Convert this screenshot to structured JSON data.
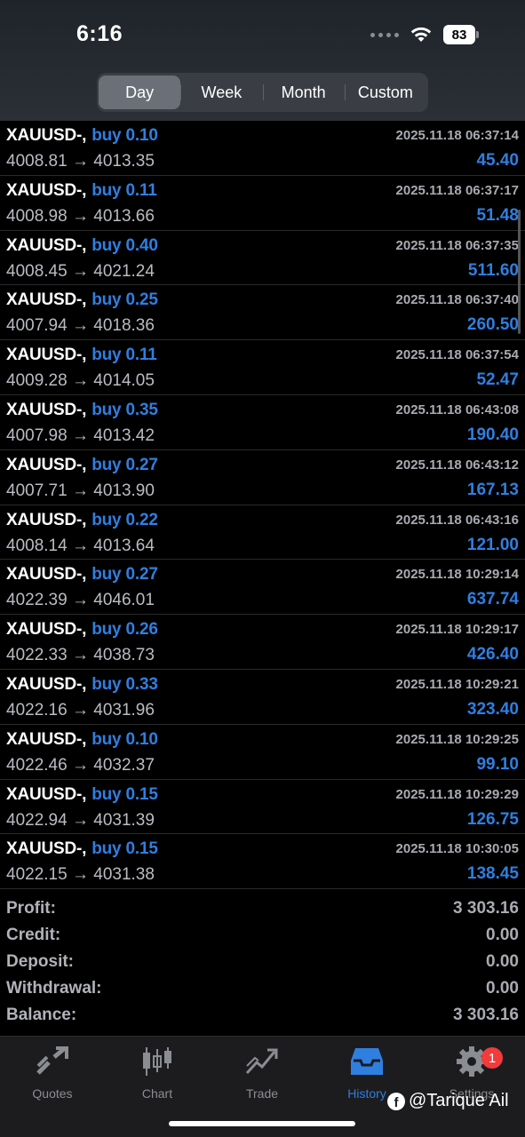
{
  "status": {
    "time": "6:16",
    "battery": "83"
  },
  "segments": [
    {
      "label": "Day",
      "active": true
    },
    {
      "label": "Week",
      "active": false
    },
    {
      "label": "Month",
      "active": false
    },
    {
      "label": "Custom",
      "active": false
    }
  ],
  "deals": [
    {
      "symbol": "XAUUSD-,",
      "dir": "buy 0.10",
      "open": "4008.81",
      "close": "4013.35",
      "time": "2025.11.18 06:37:14",
      "profit": "45.40"
    },
    {
      "symbol": "XAUUSD-,",
      "dir": "buy 0.11",
      "open": "4008.98",
      "close": "4013.66",
      "time": "2025.11.18 06:37:17",
      "profit": "51.48"
    },
    {
      "symbol": "XAUUSD-,",
      "dir": "buy 0.40",
      "open": "4008.45",
      "close": "4021.24",
      "time": "2025.11.18 06:37:35",
      "profit": "511.60"
    },
    {
      "symbol": "XAUUSD-,",
      "dir": "buy 0.25",
      "open": "4007.94",
      "close": "4018.36",
      "time": "2025.11.18 06:37:40",
      "profit": "260.50"
    },
    {
      "symbol": "XAUUSD-,",
      "dir": "buy 0.11",
      "open": "4009.28",
      "close": "4014.05",
      "time": "2025.11.18 06:37:54",
      "profit": "52.47"
    },
    {
      "symbol": "XAUUSD-,",
      "dir": "buy 0.35",
      "open": "4007.98",
      "close": "4013.42",
      "time": "2025.11.18 06:43:08",
      "profit": "190.40"
    },
    {
      "symbol": "XAUUSD-,",
      "dir": "buy 0.27",
      "open": "4007.71",
      "close": "4013.90",
      "time": "2025.11.18 06:43:12",
      "profit": "167.13"
    },
    {
      "symbol": "XAUUSD-,",
      "dir": "buy 0.22",
      "open": "4008.14",
      "close": "4013.64",
      "time": "2025.11.18 06:43:16",
      "profit": "121.00"
    },
    {
      "symbol": "XAUUSD-,",
      "dir": "buy 0.27",
      "open": "4022.39",
      "close": "4046.01",
      "time": "2025.11.18 10:29:14",
      "profit": "637.74"
    },
    {
      "symbol": "XAUUSD-,",
      "dir": "buy 0.26",
      "open": "4022.33",
      "close": "4038.73",
      "time": "2025.11.18 10:29:17",
      "profit": "426.40"
    },
    {
      "symbol": "XAUUSD-,",
      "dir": "buy 0.33",
      "open": "4022.16",
      "close": "4031.96",
      "time": "2025.11.18 10:29:21",
      "profit": "323.40"
    },
    {
      "symbol": "XAUUSD-,",
      "dir": "buy 0.10",
      "open": "4022.46",
      "close": "4032.37",
      "time": "2025.11.18 10:29:25",
      "profit": "99.10"
    },
    {
      "symbol": "XAUUSD-,",
      "dir": "buy 0.15",
      "open": "4022.94",
      "close": "4031.39",
      "time": "2025.11.18 10:29:29",
      "profit": "126.75"
    },
    {
      "symbol": "XAUUSD-,",
      "dir": "buy 0.15",
      "open": "4022.15",
      "close": "4031.38",
      "time": "2025.11.18 10:30:05",
      "profit": "138.45"
    }
  ],
  "arrow": "→",
  "summary": [
    {
      "label": "Profit:",
      "value": "3 303.16"
    },
    {
      "label": "Credit:",
      "value": "0.00"
    },
    {
      "label": "Deposit:",
      "value": "0.00"
    },
    {
      "label": "Withdrawal:",
      "value": "0.00"
    },
    {
      "label": "Balance:",
      "value": "3 303.16"
    }
  ],
  "tabs": [
    {
      "label": "Quotes",
      "icon": "quotes-icon"
    },
    {
      "label": "Chart",
      "icon": "chart-icon"
    },
    {
      "label": "Trade",
      "icon": "trade-icon"
    },
    {
      "label": "History",
      "icon": "history-icon",
      "active": true
    },
    {
      "label": "Settings",
      "icon": "gear-icon",
      "badge": "1"
    }
  ],
  "watermark": "@Tarique Ail",
  "colors": {
    "accent": "#2f7fe0",
    "badge": "#f23b3b"
  }
}
